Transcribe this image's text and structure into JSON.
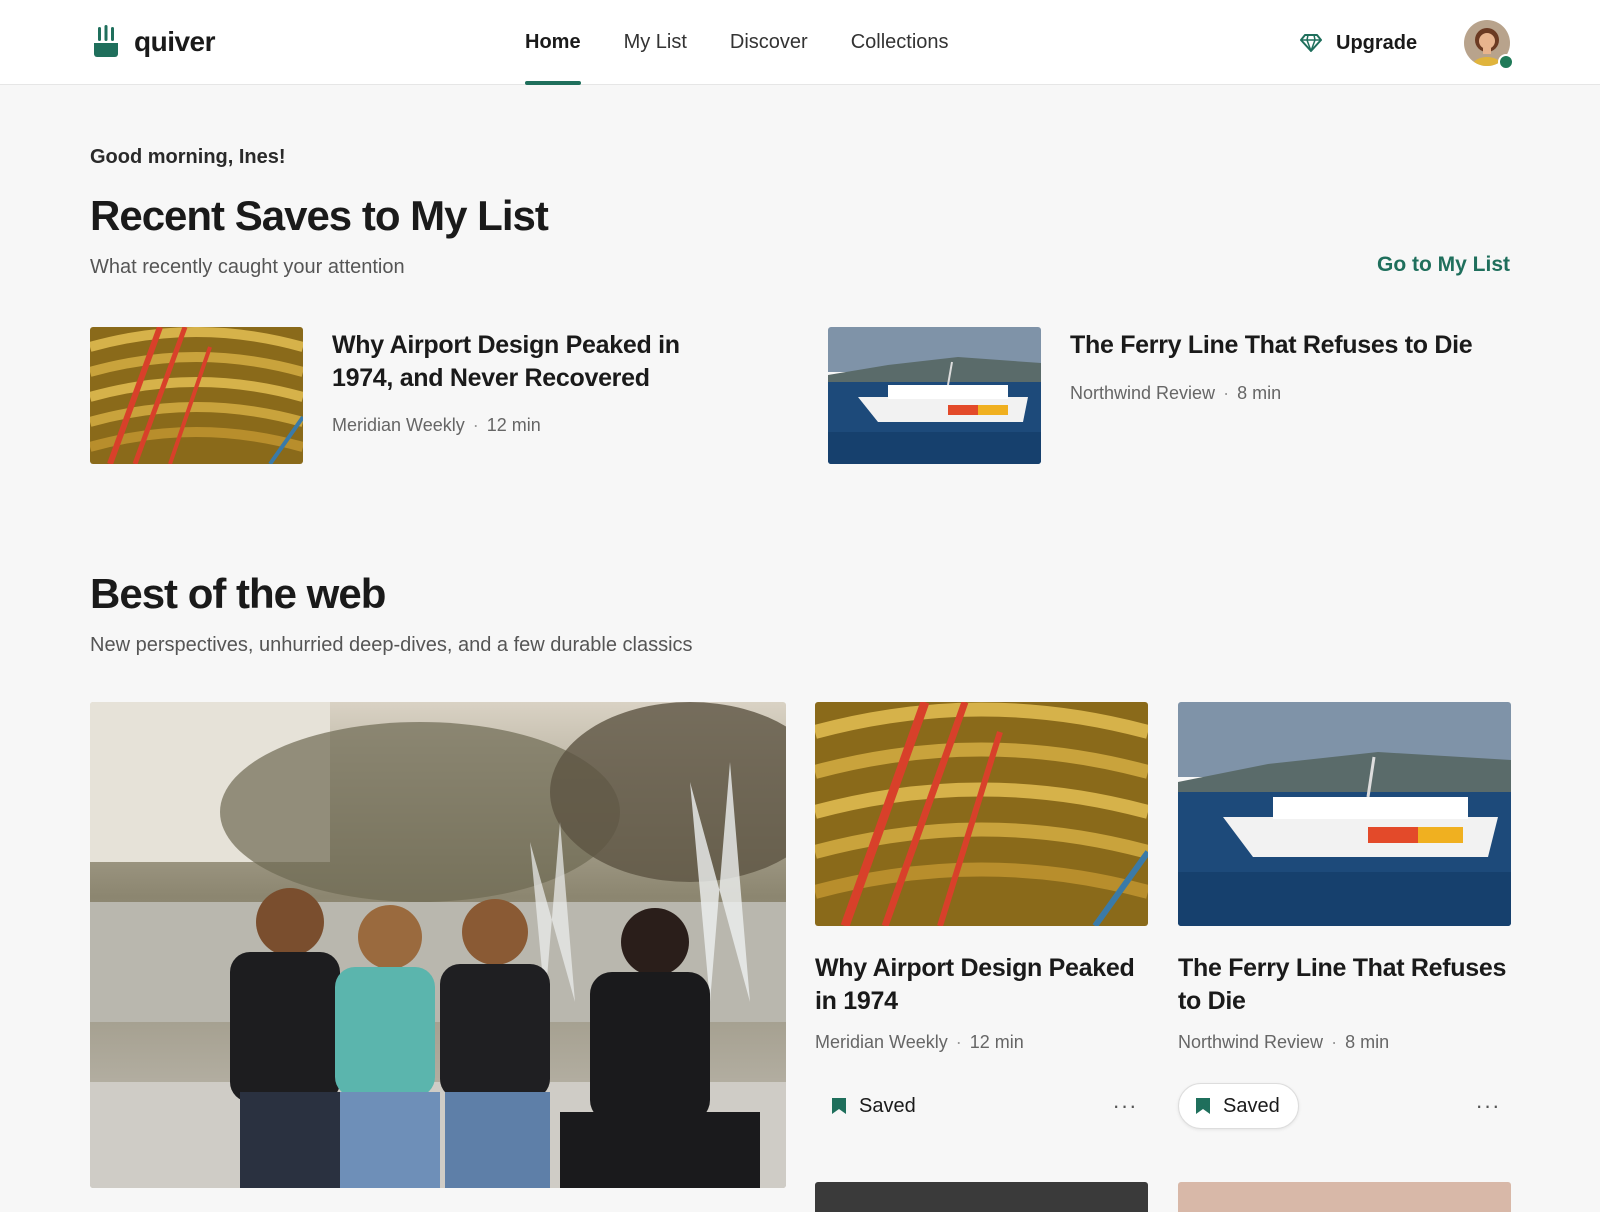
{
  "app": {
    "name": "quiver"
  },
  "nav": {
    "items": [
      {
        "label": "Home",
        "active": true
      },
      {
        "label": "My List"
      },
      {
        "label": "Discover"
      },
      {
        "label": "Collections"
      }
    ]
  },
  "header": {
    "upgrade_label": "Upgrade",
    "avatar_icon": "user-avatar-icon",
    "upgrade_icon": "diamond-icon"
  },
  "greeting": "Good morning, Ines!",
  "recent": {
    "title": "Recent Saves to My List",
    "subtitle": "What recently caught your attention",
    "link": "Go to My List",
    "items": [
      {
        "title": "Why Airport Design Peaked in 1974, and Never Recovered",
        "source": "Meridian Weekly",
        "time": "12 min"
      },
      {
        "title": "The Ferry Line That Refuses to Die",
        "source": "Northwind Review",
        "time": "8 min"
      }
    ]
  },
  "best": {
    "title": "Best of the web",
    "subtitle": "New perspectives, unhurried deep-dives, and a few durable classics",
    "cards": [
      {
        "title": "Why Airport Design Peaked in 1974",
        "source": "Meridian Weekly",
        "time": "12 min",
        "save_label": "Saved"
      },
      {
        "title": "The Ferry Line That Refuses to Die",
        "source": "Northwind Review",
        "time": "8 min",
        "save_label": "Saved"
      }
    ]
  },
  "colors": {
    "accent": "#1f6f5c",
    "background": "#f7f7f7"
  }
}
